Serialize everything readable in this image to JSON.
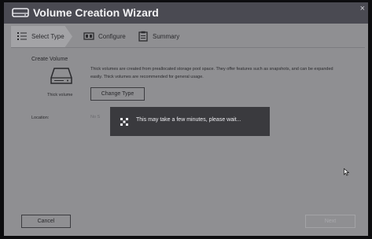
{
  "window": {
    "title": "Volume Creation Wizard",
    "close_glyph": "×"
  },
  "steps": [
    {
      "label": "Select Type",
      "icon": "list-icon",
      "active": true
    },
    {
      "label": "Configure",
      "icon": "sliders-icon",
      "active": false
    },
    {
      "label": "Summary",
      "icon": "clipboard-icon",
      "active": false
    }
  ],
  "create_volume": {
    "title": "Create Volume",
    "drive_label": "Thick volume",
    "description": "Thick volumes are created from preallocated storage pool space. They offer features such as snapshots, and can be expanded easily. Thick volumes are recommended for general usage.",
    "change_type_label": "Change Type"
  },
  "location": {
    "label": "Location:",
    "value": "No S"
  },
  "footer": {
    "cancel_label": "Cancel",
    "next_label": "Next"
  },
  "loading": {
    "message": "This may take a few minutes, please wait..."
  },
  "colors": {
    "overlay": "#8f8f92",
    "titlebar": "#4a4a52",
    "toast": "#3a3a3e"
  }
}
